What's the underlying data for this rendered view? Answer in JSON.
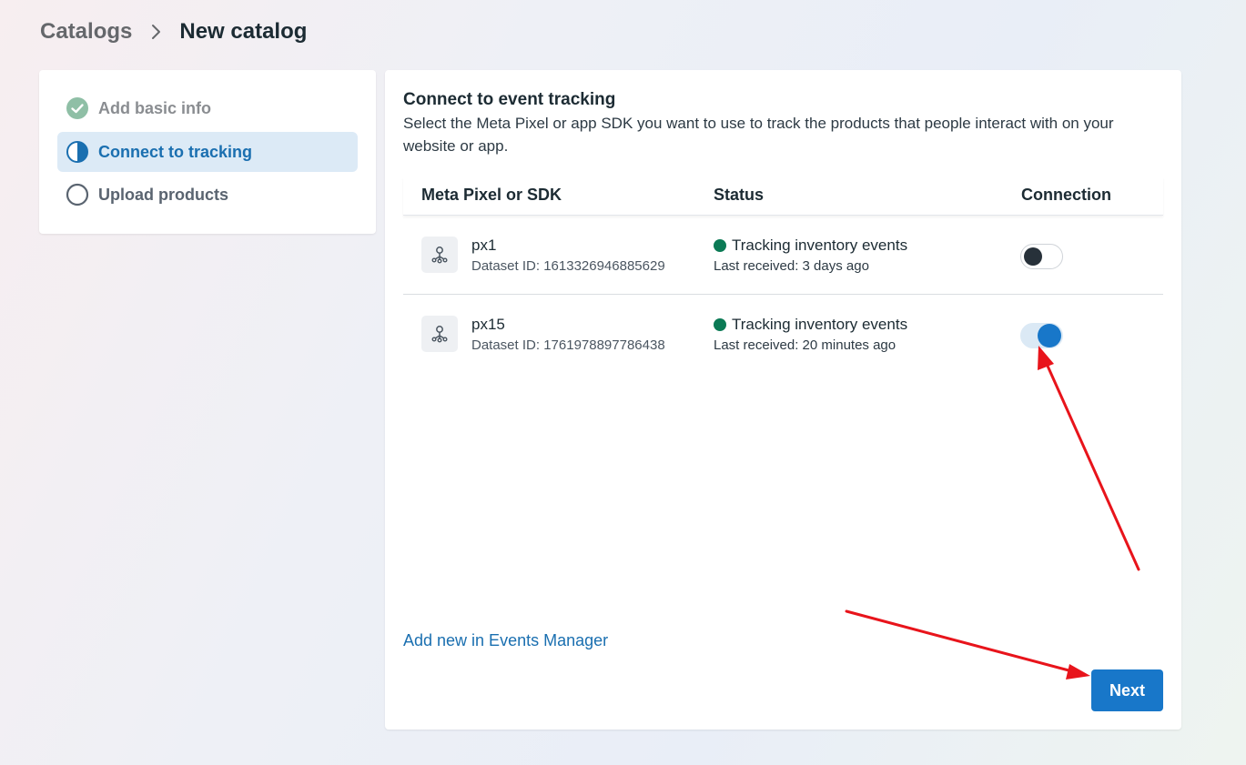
{
  "breadcrumb": {
    "parent": "Catalogs",
    "current": "New catalog",
    "separator_icon": "chevron-right-icon"
  },
  "steps": [
    {
      "label": "Add basic info",
      "state": "done",
      "icon": "check-circle-icon"
    },
    {
      "label": "Connect to tracking",
      "state": "active",
      "icon": "half-circle-icon"
    },
    {
      "label": "Upload products",
      "state": "todo",
      "icon": "empty-circle-icon"
    }
  ],
  "main": {
    "title": "Connect to event tracking",
    "description": "Select the Meta Pixel or app SDK you want to use to track the products that people interact with on your website or app.",
    "table": {
      "headers": {
        "pixel": "Meta Pixel or SDK",
        "status": "Status",
        "connection": "Connection"
      },
      "rows": [
        {
          "name": "px1",
          "dataset_id": "Dataset ID: 1613326946885629",
          "status": "Tracking inventory events",
          "last_received": "Last received: 3 days ago",
          "connected": false
        },
        {
          "name": "px15",
          "dataset_id": "Dataset ID: 1761978897786438",
          "status": "Tracking inventory events",
          "last_received": "Last received: 20 minutes ago",
          "connected": true
        }
      ]
    },
    "add_link": "Add new in Events Manager",
    "next_button": "Next"
  },
  "colors": {
    "accent": "#1877c9",
    "status_green": "#0b7a55",
    "annotation_red": "#e8141b"
  }
}
